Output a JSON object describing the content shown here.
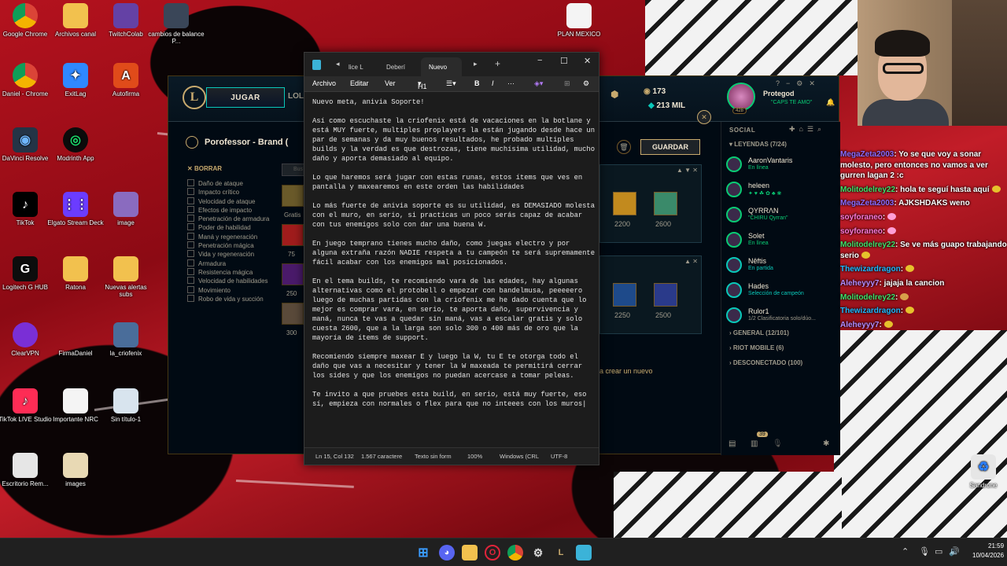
{
  "desktop": {
    "icons": [
      {
        "label": "Google Chrome"
      },
      {
        "label": "Archivos canal"
      },
      {
        "label": "TwitchColab"
      },
      {
        "label": "cambios de balance P..."
      },
      {
        "label": "PLAN MEXICO"
      },
      {
        "label": "Daniel - Chrome"
      },
      {
        "label": "ExitLag"
      },
      {
        "label": "Autofirma"
      },
      {
        "label": "DaVinci Resolve"
      },
      {
        "label": "Modrinth App"
      },
      {
        "label": "TikTok"
      },
      {
        "label": "Elgato Stream Deck"
      },
      {
        "label": "image"
      },
      {
        "label": "Logitech G HUB"
      },
      {
        "label": "Ratona"
      },
      {
        "label": "Nuevas alertas subs"
      },
      {
        "label": "ClearVPN"
      },
      {
        "label": "FirmaDaniel"
      },
      {
        "label": "la_criofenix"
      },
      {
        "label": "TikTok LIVE Studio"
      },
      {
        "label": "Importante NRC"
      },
      {
        "label": "Sin título-1"
      },
      {
        "label": "Escritorio Rem..."
      },
      {
        "label": "images"
      },
      {
        "label": "Sandrone"
      }
    ]
  },
  "league": {
    "play_label": "JUGAR",
    "tab_partial": "LOL",
    "rp": "173",
    "be": "213 MIL",
    "profile_name": "Protegod",
    "profile_status": "\"CAPS TE AMO\"",
    "profile_level": "428",
    "build_title": "Porofessor - Brand (",
    "clear_label": "BORRAR",
    "save_label": "GUARDAR",
    "search_placeholder": "Bus",
    "filters": [
      "Daño de ataque",
      "Impacto crítico",
      "Velocidad de ataque",
      "Efectos de impacto",
      "Penetración de armadura",
      "Poder de habilidad",
      "Maná y regeneración",
      "Penetración mágica",
      "Vida y regeneración",
      "Armadura",
      "Resistencia mágica",
      "Velocidad de habilidades",
      "Movimiento",
      "Robo de vida y succión"
    ],
    "item_labels": [
      "Gratis",
      "75",
      "250",
      "300"
    ],
    "rec_values_1": [
      "2200",
      "2600"
    ],
    "rec_values_2": [
      "2250",
      "2500"
    ],
    "create_new": "a crear un nuevo",
    "social": {
      "title": "SOCIAL",
      "group_friends": "LEYENDAS (7/24)",
      "friends": [
        {
          "name": "AaronVantaris",
          "status": "En línea"
        },
        {
          "name": "heleen",
          "status": "✦ ♥ ☘ ✿ ♣ ❀"
        },
        {
          "name": "QYRRΛN",
          "status": "\"CHIRU Qyrran\""
        },
        {
          "name": "Solet",
          "status": "En línea"
        },
        {
          "name": "Nêftis",
          "status": "En partida"
        },
        {
          "name": "Hades",
          "status": "Selección de campeón"
        },
        {
          "name": "Rulor1",
          "status": "1/2 Clasificatoria solo/dúo..."
        }
      ],
      "group_general": "GENERAL (12/101)",
      "group_riot": "RIOT MOBILE (6)",
      "group_offline": "DESCONECTADO (100)",
      "notif_count": "39"
    }
  },
  "notepad": {
    "tabs": [
      "lice L",
      "Deberí",
      "Nuevo"
    ],
    "menu": [
      "Archivo",
      "Editar",
      "Ver"
    ],
    "heading": "H1",
    "text": "Nuevo meta, anivia Soporte!\n\nAsí como escuchaste la criofenix está de vacaciones en la botlane y está MUY fuerte, multiples proplayers la están jugando desde hace un par de semanas y da muy buenos resultados, he probado multiples builds y la verdad es que destrozas, tiene muchísima utilidad, mucho daño y aporta demasiado al equipo.\n\nLo que haremos será jugar con estas runas, estos ítems que ves en pantalla y maxearemos en este orden las habilidades\n\nLo más fuerte de anivia soporte es su utilidad, es DEMASIADO molesta con el muro, en serio, si practicas un poco serás capaz de acabar con tus enemigos solo con dar una buena W.\n\nEn juego temprano tienes mucho daño, como juegas electro y por alguna extraña razón NADIE respeta a tu campeón te será supremamente fácil acabar con los enemigos mal posicionados.\n\nEn el tema builds, te recomiendo vara de las edades, hay algunas alternativas como el protobell o empezar con bandelmusa, peeeeero luego de muchas partidas con la criofenix me he dado cuenta que lo mejor es comprar vara, en serio, te aporta daño, supervivencia y maná, nunca te vas a quedar sin maná, vas a escalar gratis y solo cuesta 2600, que a la larga son solo 300 o 400 más de oro que la mayoría de ítems de support.\n\nRecomiendo siempre maxear E y luego la W, tu E te otorga todo el daño que vas a necesitar y tener la W maxeada te permitirá cerrar los sides y que los enemigos no puedan acercase a tomar peleas.\n\nTe invito a que pruebes esta build, en serio, está muy fuerte, eso sí, empieza con normales o flex para que no inteees con los muros|",
    "status": {
      "position": "Ln 15, Col 132",
      "chars": "1.567 caractere",
      "format": "Texto sin form",
      "zoom": "100%",
      "eol": "Windows (CRL",
      "encoding": "UTF-8"
    }
  },
  "chat": [
    {
      "user": "MegaZeta2003",
      "color": "#8a6bff",
      "text": ": Yo se que voy a sonar molesto, pero entonces no vamos a ver gurren lagan 2 :c"
    },
    {
      "user": "Molitodelrey22",
      "color": "#3fe06a",
      "text": ": hola te seguí hasta aquí"
    },
    {
      "user": "MegaZeta2003",
      "color": "#8a6bff",
      "text": ": AJKSHDAKS weno"
    },
    {
      "user": "soyforaneo",
      "color": "#ff7ad9",
      "text": ":"
    },
    {
      "user": "soyforaneo",
      "color": "#ff7ad9",
      "text": ":"
    },
    {
      "user": "Molitodelrey22",
      "color": "#3fe06a",
      "text": ": Se ve más guapo trabajando serio"
    },
    {
      "user": "Thewizardragon",
      "color": "#1fb8ff",
      "text": ":"
    },
    {
      "user": "Aleheyyy7",
      "color": "#b48cff",
      "text": ": jajaja la cancion"
    },
    {
      "user": "Molitodelrey22",
      "color": "#3fe06a",
      "text": ":"
    },
    {
      "user": "Thewizardragon",
      "color": "#1fb8ff",
      "text": ":"
    },
    {
      "user": "Aleheyyy7",
      "color": "#b48cff",
      "text": ":"
    }
  ],
  "taskbar": {
    "time": "21:59",
    "date": "10/04/2026"
  }
}
